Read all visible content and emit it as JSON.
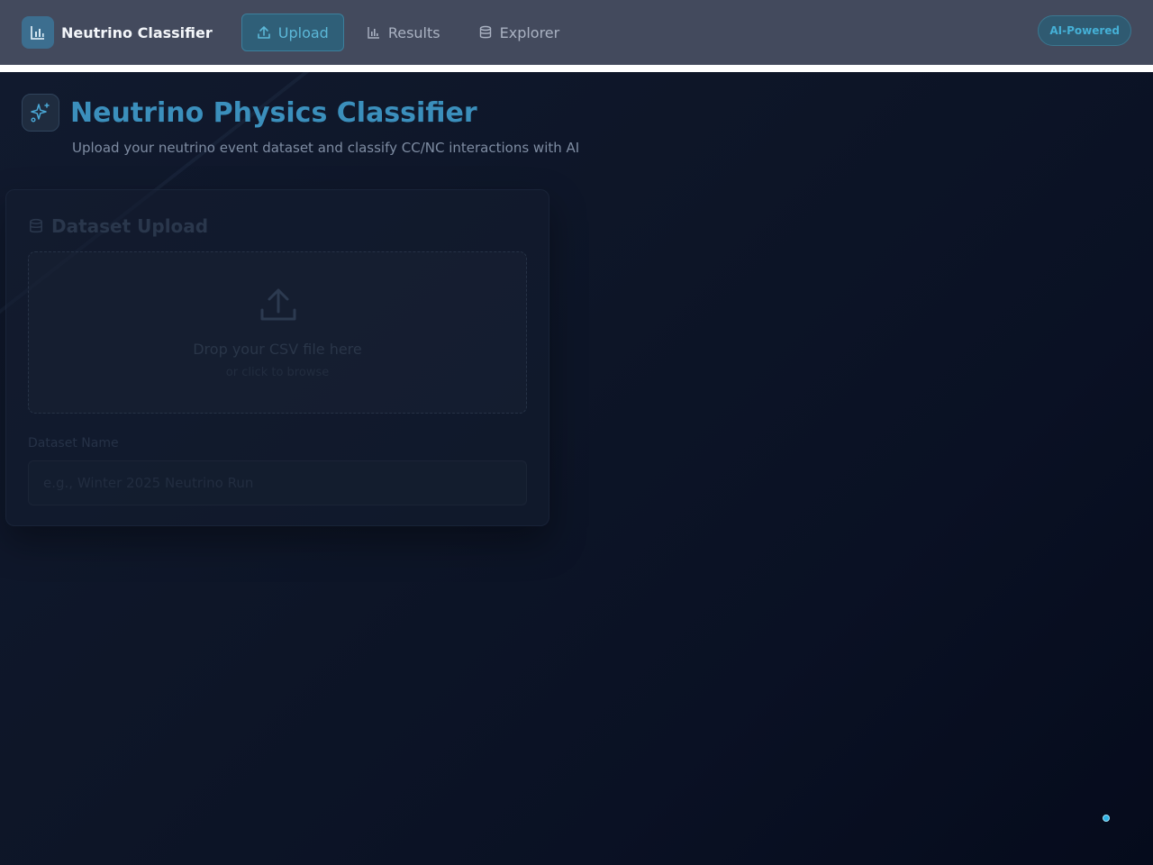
{
  "app": {
    "brand_title": "Neutrino Classifier",
    "badge": "AI-Powered"
  },
  "nav": {
    "items": [
      {
        "label": "Upload",
        "icon": "upload-icon",
        "active": true
      },
      {
        "label": "Results",
        "icon": "bar-chart-icon",
        "active": false
      },
      {
        "label": "Explorer",
        "icon": "database-icon",
        "active": false
      }
    ]
  },
  "page": {
    "title": "Neutrino Physics Classifier",
    "subtitle": "Upload your neutrino event dataset and classify CC/NC interactions with AI"
  },
  "upload_card": {
    "title": "Dataset Upload",
    "dropzone_main": "Drop your CSV file here",
    "dropzone_sub": "or click to browse",
    "name_label": "Dataset Name",
    "name_placeholder": "e.g., Winter 2025 Neutrino Run",
    "name_value": ""
  },
  "colors": {
    "accent": "#3b8fbc",
    "nav_bg": "#434a5d",
    "page_bg": "#0b1120"
  }
}
